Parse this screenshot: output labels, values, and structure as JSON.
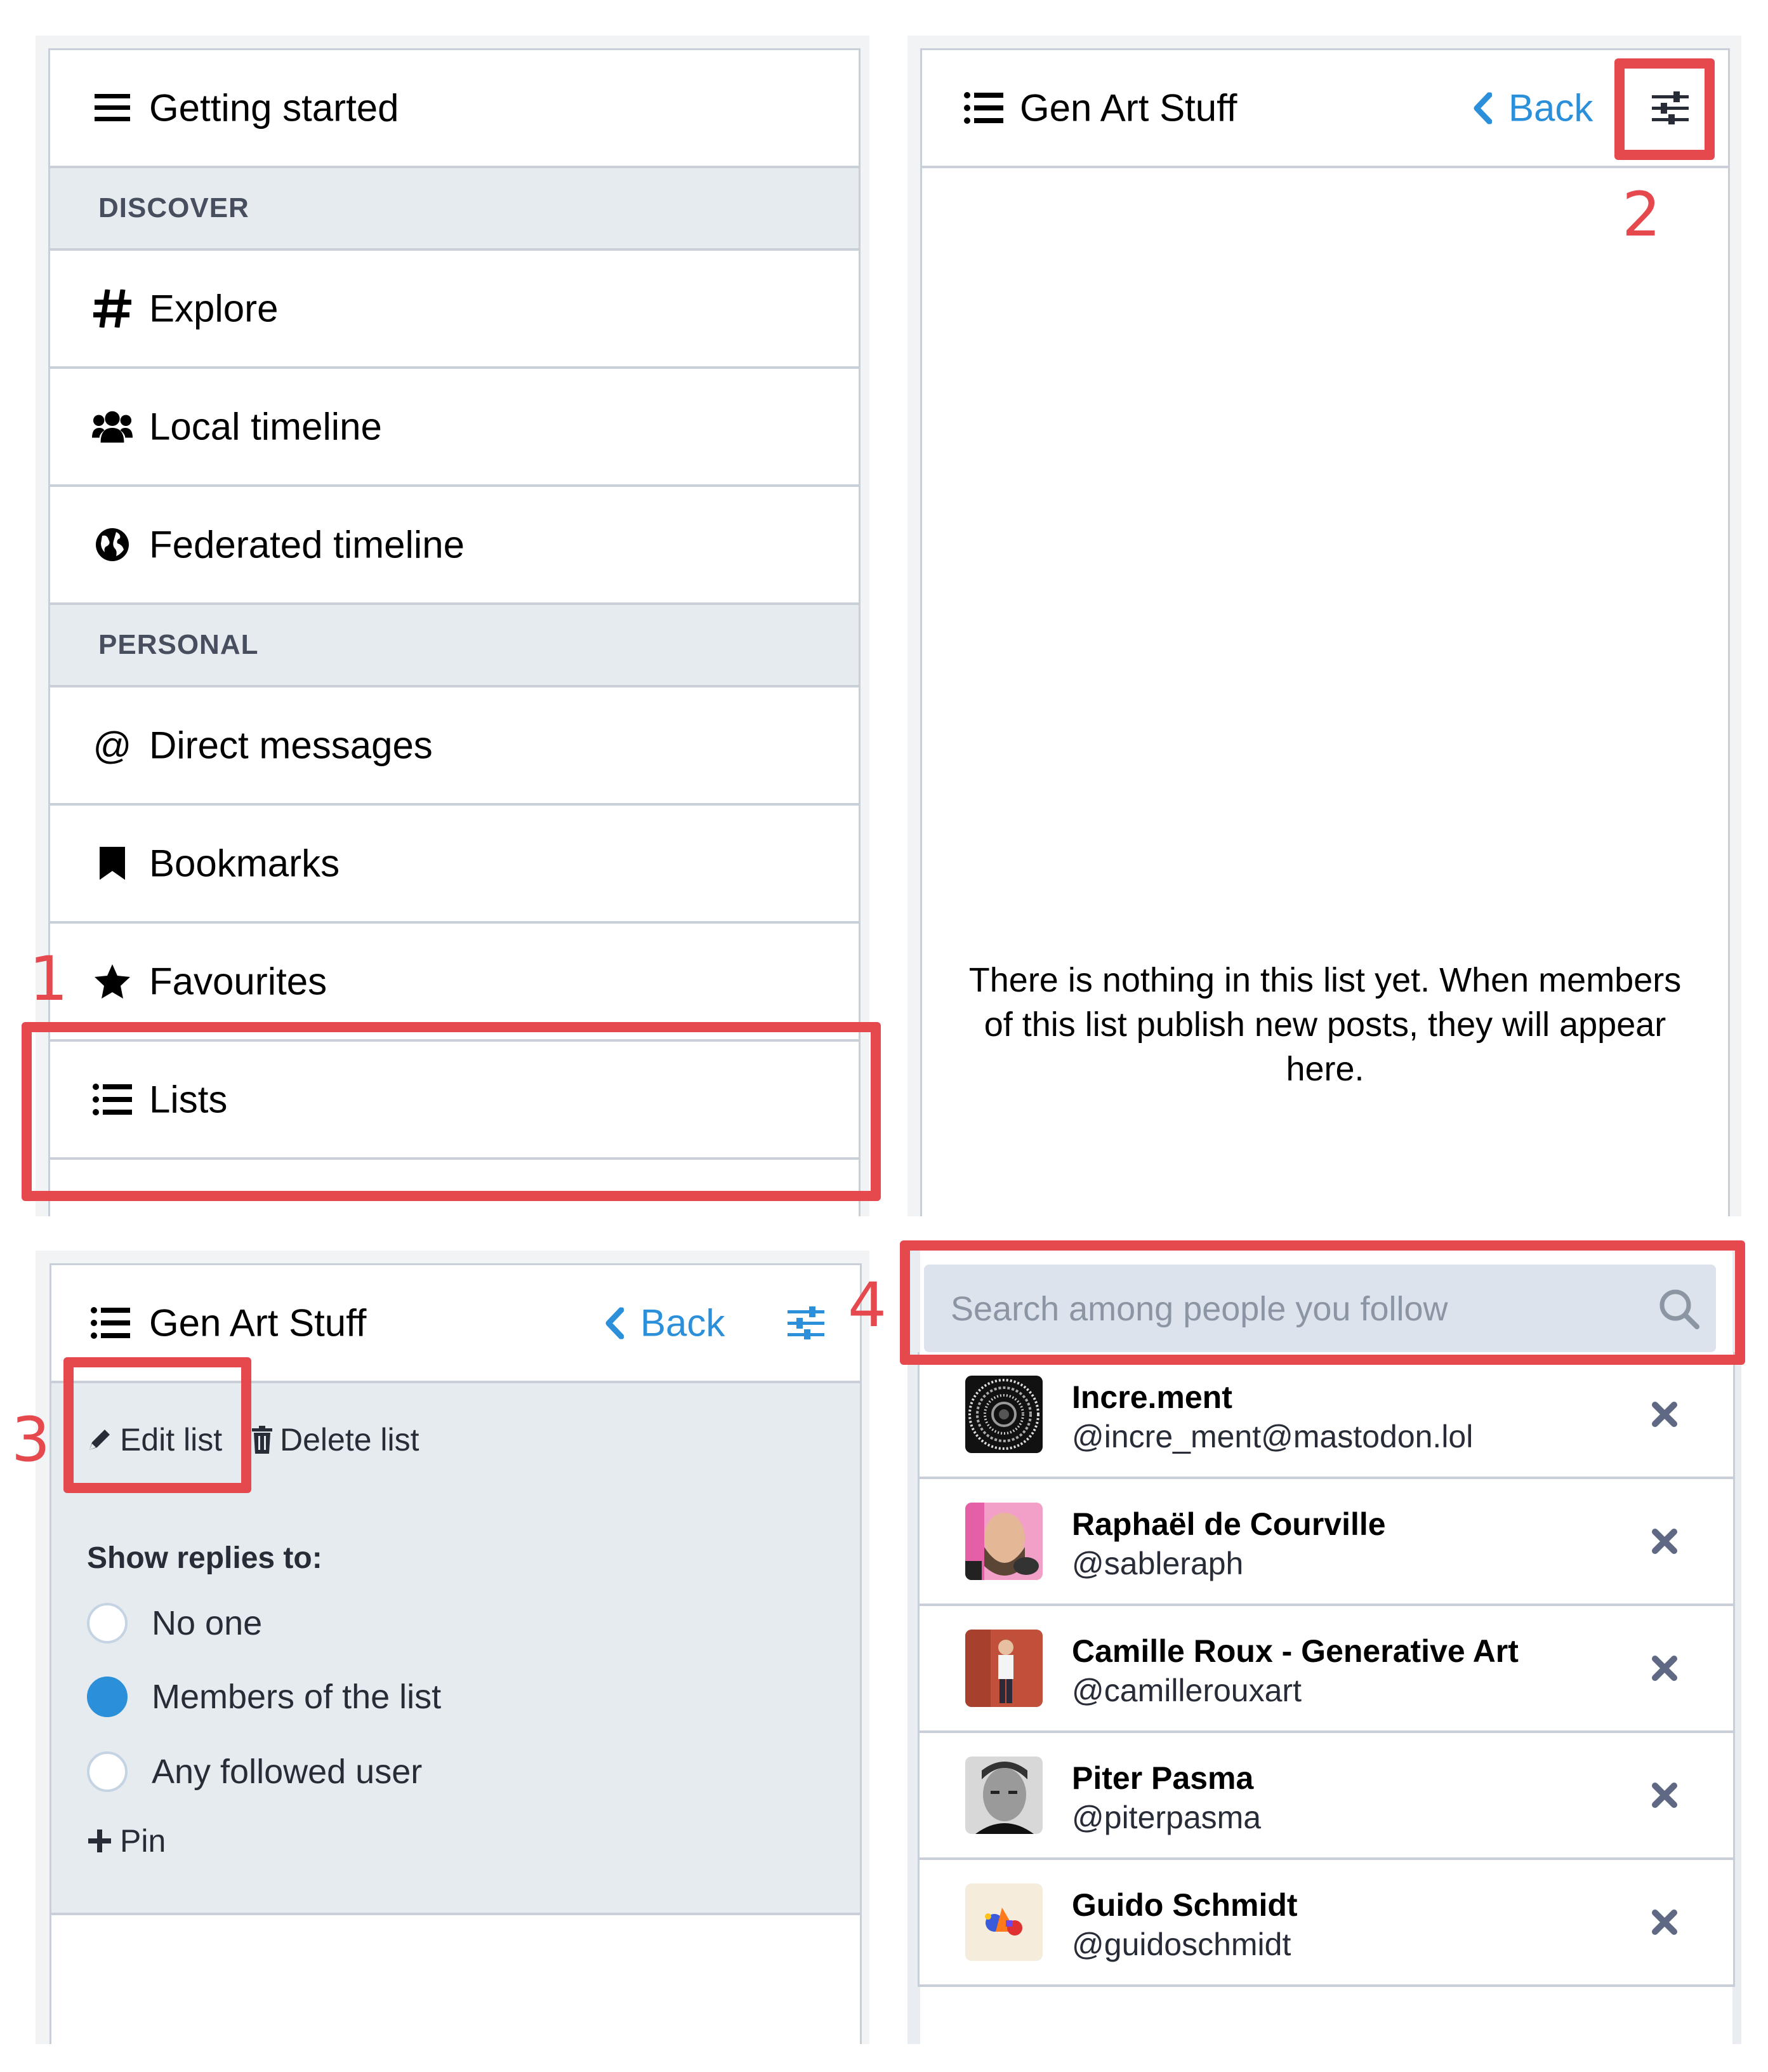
{
  "panel1": {
    "getting_started": "Getting started",
    "discover": "DISCOVER",
    "explore": "Explore",
    "local_timeline": "Local timeline",
    "federated_timeline": "Federated timeline",
    "personal": "PERSONAL",
    "direct_messages": "Direct messages",
    "bookmarks": "Bookmarks",
    "favourites": "Favourites",
    "lists": "Lists"
  },
  "panel2": {
    "title": "Gen Art Stuff",
    "back": "Back",
    "empty_message": "There is nothing in this list yet. When members of this list publish new posts, they will appear here."
  },
  "panel3": {
    "title": "Gen Art Stuff",
    "back": "Back",
    "edit_list": "Edit list",
    "delete_list": "Delete list",
    "show_replies_to": "Show replies to:",
    "options": [
      "No one",
      "Members of the list",
      "Any followed user"
    ],
    "selected_option": "Members of the list",
    "pin": "Pin"
  },
  "panel4": {
    "search_placeholder": "Search among people you follow",
    "accounts": [
      {
        "name": "Incre.ment",
        "handle": "@incre_ment@mastodon.lol"
      },
      {
        "name": "Raphaël de Courville",
        "handle": "@sableraph"
      },
      {
        "name": "Camille Roux - Generative Art",
        "handle": "@camillerouxart"
      },
      {
        "name": "Piter Pasma",
        "handle": "@piterpasma"
      },
      {
        "name": "Guido Schmidt",
        "handle": "@guidoschmidt"
      }
    ]
  },
  "annotations": {
    "step1": "1",
    "step2": "2",
    "step3": "3",
    "step4": "4"
  },
  "colors": {
    "accent": "#2b90d9",
    "highlight": "#e5484d",
    "section_bg": "#e6ebf0",
    "border": "#c8cfd9"
  },
  "icons": {
    "getting_started": "hamburger-icon",
    "explore": "hashtag-icon",
    "local_timeline": "users-icon",
    "federated_timeline": "globe-icon",
    "direct_messages": "at-icon",
    "bookmarks": "bookmark-icon",
    "favourites": "star-icon",
    "lists": "list-icon",
    "settings": "sliders-icon",
    "back": "chevron-left-icon",
    "search": "search-icon",
    "remove": "times-icon",
    "edit": "pencil-icon",
    "delete": "trash-icon",
    "pin": "plus-icon"
  }
}
